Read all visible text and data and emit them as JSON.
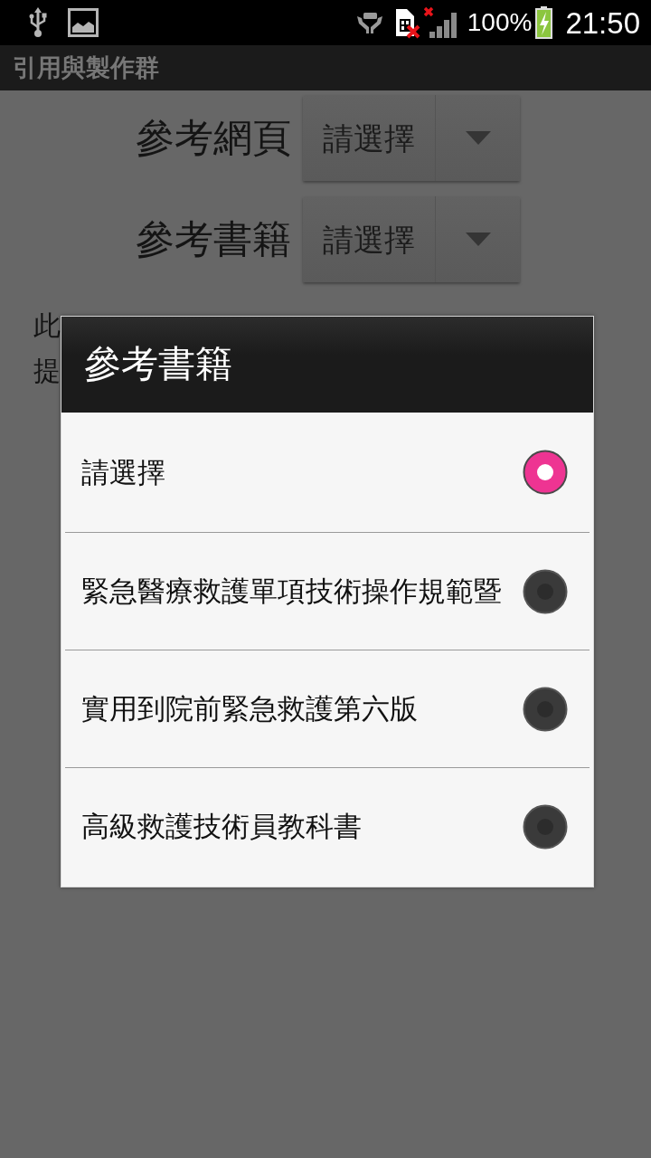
{
  "status_bar": {
    "battery": "100%",
    "time": "21:50"
  },
  "title_bar": {
    "title": "引用與製作群"
  },
  "form": {
    "fields": [
      {
        "label": "參考網頁",
        "value": "請選擇"
      },
      {
        "label": "參考書籍",
        "value": "請選擇"
      }
    ],
    "description_lines": [
      "此",
      "提"
    ]
  },
  "dialog": {
    "title": "參考書籍",
    "options": [
      {
        "label": "請選擇",
        "selected": true
      },
      {
        "label": "緊急醫療救護單項技術操作規範暨",
        "selected": false
      },
      {
        "label": "實用到院前緊急救護第六版",
        "selected": false
      },
      {
        "label": "高級救護技術員教科書",
        "selected": false
      }
    ]
  }
}
